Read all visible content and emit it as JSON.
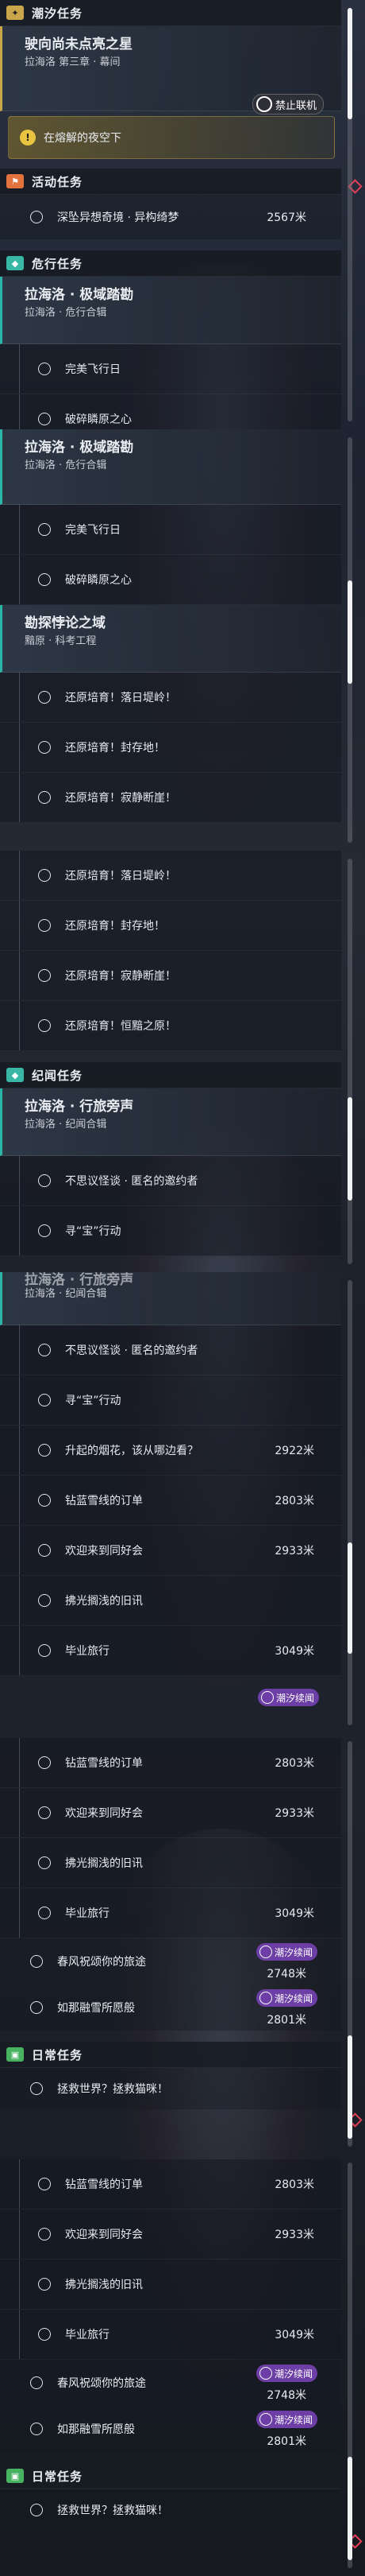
{
  "panel1": {
    "header": {
      "icon": "star-icon",
      "title": "潮汐任务"
    },
    "card": {
      "title": "驶向尚未点亮之星",
      "subtitle": "拉海洛 第三章 · 幕间"
    },
    "tag": {
      "icon": "ban-icon",
      "label": "禁止联机"
    },
    "subquest": {
      "icon": "exclaim-icon",
      "label": "在熔解的夜空下"
    },
    "activity": {
      "icon": "flag-icon",
      "title": "活动任务",
      "item": "深坠异想奇境 · 异构绮梦",
      "distance": "2567米"
    },
    "danger": {
      "icon": "danger-icon",
      "title": "危行任务"
    },
    "card2": {
      "title": "拉海洛 · 极域踏勘",
      "subtitle": "拉海洛 · 危行合辑"
    },
    "rows": [
      "完美飞行日",
      "破碎瞵原之心"
    ]
  },
  "panel2": {
    "card": {
      "title": "拉海洛 · 极域踏勘",
      "subtitle": "拉海洛 · 危行合辑"
    },
    "rows": [
      "完美飞行日",
      "破碎瞵原之心"
    ],
    "card2": {
      "title": "勘探悖论之域",
      "subtitle": "黯原 · 科考工程"
    },
    "rows2": [
      "还原培育！落日堤岭！",
      "还原培育！封存地！",
      "还原培育！寂静断崖！"
    ]
  },
  "panel3": {
    "rows": [
      "还原培育！落日堤岭！",
      "还原培育！封存地！",
      "还原培育！寂静断崖！",
      "还原培育！恒黯之原！"
    ],
    "header": {
      "icon": "book-icon",
      "title": "纪闻任务"
    },
    "card": {
      "title": "拉海洛 · 行旅旁声",
      "subtitle": "拉海洛 · 纪闻合辑"
    },
    "rows2": [
      "不思议怪谈 · 匿名的邀约者",
      "寻“宝”行动"
    ]
  },
  "panel4": {
    "card": {
      "title": "拉海洛 · 行旅旁声",
      "subtitle": "拉海洛 · 纪闻合辑"
    },
    "rows": [
      {
        "label": "不思议怪谈 · 匿名的邀约者",
        "distance": ""
      },
      {
        "label": "寻“宝”行动",
        "distance": ""
      },
      {
        "label": "升起的烟花，该从哪边看？",
        "distance": "2922米"
      },
      {
        "label": "钻蓝雪线的订单",
        "distance": "2803米"
      },
      {
        "label": "欢迎来到同好会",
        "distance": "2933米"
      },
      {
        "label": "拂光搁浅的旧讯",
        "distance": ""
      },
      {
        "label": "毕业旅行",
        "distance": "3049米"
      }
    ],
    "badge": "潮汐续闻"
  },
  "panel5": {
    "rows": [
      {
        "label": "钻蓝雪线的订单",
        "distance": "2803米"
      },
      {
        "label": "欢迎来到同好会",
        "distance": "2933米"
      },
      {
        "label": "拂光搁浅的旧讯",
        "distance": ""
      },
      {
        "label": "毕业旅行",
        "distance": "3049米"
      }
    ],
    "rowsb": [
      {
        "label": "春风祝颂你的旅途",
        "distance": "2748米",
        "badge": "潮汐续闻"
      },
      {
        "label": "如那融雪所愿般",
        "distance": "2801米",
        "badge": "潮汐续闻"
      }
    ],
    "daily": {
      "icon": "calendar-icon",
      "title": "日常任务",
      "item": "拯救世界？拯救猫咪！"
    }
  },
  "panel6": {
    "rows": [
      {
        "label": "钻蓝雪线的订单",
        "distance": "2803米"
      },
      {
        "label": "欢迎来到同好会",
        "distance": "2933米"
      },
      {
        "label": "拂光搁浅的旧讯",
        "distance": ""
      },
      {
        "label": "毕业旅行",
        "distance": "3049米"
      }
    ],
    "rowsb": [
      {
        "label": "春风祝颂你的旅途",
        "distance": "2748米",
        "badge": "潮汐续闻"
      },
      {
        "label": "如那融雪所愿般",
        "distance": "2801米",
        "badge": "潮汐续闻"
      }
    ],
    "daily": {
      "icon": "calendar-icon",
      "title": "日常任务",
      "item": "拯救世界？拯救猫咪！"
    }
  },
  "colors": {
    "gold": "#c9a64a",
    "orange": "#e2733c",
    "teal": "#38b7a7",
    "green": "#47b25f",
    "badge": "#6d3fa6",
    "diamond": "#e4405a"
  }
}
